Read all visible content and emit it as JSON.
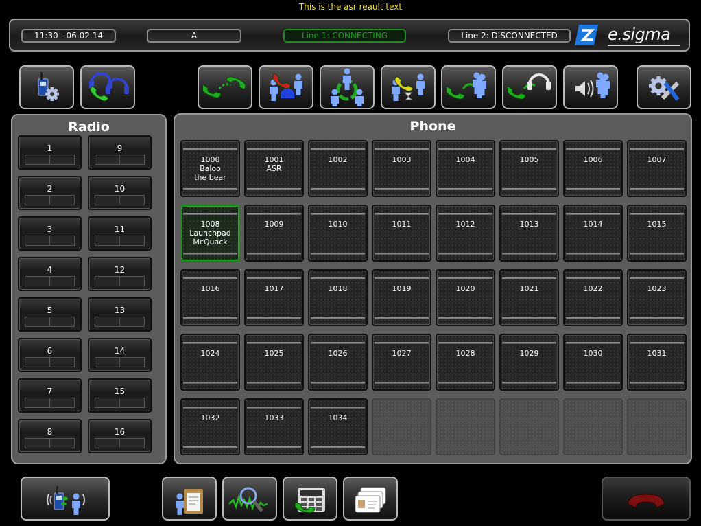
{
  "asr_text": "This is the asr reault text",
  "header": {
    "datetime": "11:30 - 06.02.14",
    "line_a": "A",
    "line1": "Line 1: CONNECTING",
    "line2": "Line 2: DISCONNECTED",
    "logo_text": "e.sigma"
  },
  "toolbar": [
    {
      "name": "radio-settings-icon"
    },
    {
      "name": "headset-call-icon"
    },
    {
      "name": "call-icon"
    },
    {
      "name": "police-alert-call-icon"
    },
    {
      "name": "conference-ring-icon"
    },
    {
      "name": "hold-wait-icon"
    },
    {
      "name": "group-call-icon"
    },
    {
      "name": "headset-transfer-icon"
    },
    {
      "name": "broadcast-speaker-icon"
    },
    {
      "name": "settings-tools-icon"
    }
  ],
  "radio": {
    "title": "Radio",
    "channels": [
      "1",
      "2",
      "3",
      "4",
      "5",
      "6",
      "7",
      "8",
      "9",
      "10",
      "11",
      "12",
      "13",
      "14",
      "15",
      "16"
    ]
  },
  "phone": {
    "title": "Phone",
    "contacts": [
      "1000\nBaloo\nthe bear",
      "1001\nASR",
      "1002",
      "1003",
      "1004",
      "1005",
      "1006",
      "1007",
      "1008\nLaunchpad\nMcQuack",
      "1009",
      "1010",
      "1011",
      "1012",
      "1013",
      "1014",
      "1015",
      "1016",
      "1017",
      "1018",
      "1019",
      "1020",
      "1021",
      "1022",
      "1023",
      "1024",
      "1025",
      "1026",
      "1027",
      "1028",
      "1029",
      "1030",
      "1031",
      "1032",
      "1033",
      "1034"
    ],
    "active_contact": "1008\nLaunchpad\nMcQuack",
    "empty_slots": 5
  },
  "bottom_bar": [
    {
      "name": "radio-to-person-icon"
    },
    {
      "name": "clipboard-person-icon"
    },
    {
      "name": "audio-search-icon"
    },
    {
      "name": "phone-keypad-icon"
    },
    {
      "name": "contact-cards-icon"
    },
    {
      "name": "hangup-icon"
    }
  ],
  "colors": {
    "asr_text": "#f0e020",
    "connecting": "#1aa01a",
    "panel": "#5c5c5c",
    "accent_blue": "#1e78e0"
  }
}
